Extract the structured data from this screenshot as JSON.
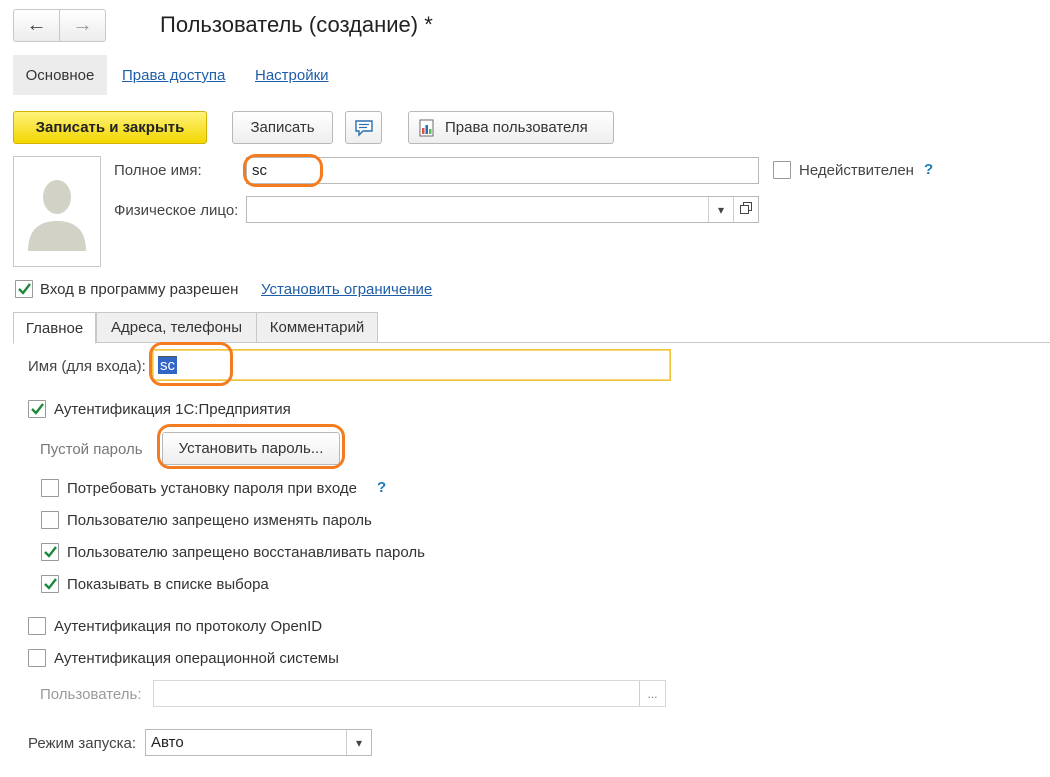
{
  "window": {
    "title": "Пользователь (создание) *",
    "nav": {
      "back_icon": "arrow-left-icon",
      "forward_icon": "arrow-right-icon"
    }
  },
  "top_tabs": [
    "Основное",
    "Права доступа",
    "Настройки"
  ],
  "toolbar": {
    "save_close": "Записать и закрыть",
    "save": "Записать",
    "comment_icon": "comment-icon",
    "rights": "Права пользователя",
    "rights_icon": "report-icon"
  },
  "form": {
    "full_name_label": "Полное имя:",
    "full_name_value": "sc",
    "invalid_label": "Недействителен",
    "help": "?",
    "person_label": "Физическое лицо:",
    "person_value": "",
    "login_allowed_label": "Вход в программу разрешен",
    "login_allowed_checked": true,
    "set_restriction_link": "Установить ограничение"
  },
  "inner_tabs": [
    "Главное",
    "Адреса, телефоны",
    "Комментарий"
  ],
  "main_tab": {
    "login_name_label": "Имя (для входа):",
    "login_name_value": "sc",
    "auth_1c_label": "Аутентификация 1С:Предприятия",
    "empty_password_label": "Пустой пароль",
    "set_password_button": "Установить пароль...",
    "options": [
      {
        "label": "Потребовать установку пароля при входе",
        "checked": false,
        "help": true
      },
      {
        "label": "Пользователю запрещено изменять пароль",
        "checked": false
      },
      {
        "label": "Пользователю запрещено восстанавливать пароль",
        "checked": true
      },
      {
        "label": "Показывать в списке выбора",
        "checked": true
      }
    ],
    "openid_label": "Аутентификация по протоколу OpenID",
    "os_auth_label": "Аутентификация операционной системы",
    "os_user_label": "Пользователь:",
    "os_user_value": "",
    "os_user_button": "...",
    "launch_mode_label": "Режим запуска:",
    "launch_mode_value": "Авто"
  },
  "colors": {
    "accent_button": "#f2d600",
    "link": "#1f5ea8",
    "annotation": "#f47b20",
    "check": "#1a8a3a"
  }
}
